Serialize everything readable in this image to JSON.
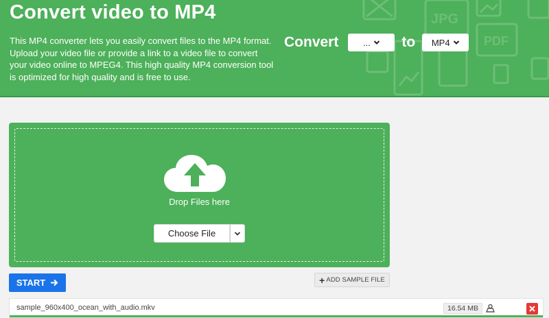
{
  "hero": {
    "title": "Convert video to MP4",
    "description": "This MP4 converter lets you easily convert files to the MP4 format. Upload your video file or provide a link to a video file to convert your video online to MPEG4. This high quality MP4 conversion tool is optimized for high quality and is free to use.",
    "convert_label": "Convert",
    "to_label": "to",
    "from_select_value": "...",
    "to_select_value": "MP4",
    "deco_labels": [
      "JPG",
      "PDF"
    ]
  },
  "dropzone": {
    "drop_text": "Drop Files here",
    "choose_file_label": "Choose File"
  },
  "actions": {
    "start_label": "START",
    "add_sample_label": "ADD SAMPLE FILE"
  },
  "file": {
    "name": "sample_960x400_ocean_with_audio.mkv",
    "size": "16.54 MB"
  },
  "colors": {
    "brand_green": "#4db05a",
    "start_blue": "#1a73e8",
    "delete_red": "#e53935"
  }
}
